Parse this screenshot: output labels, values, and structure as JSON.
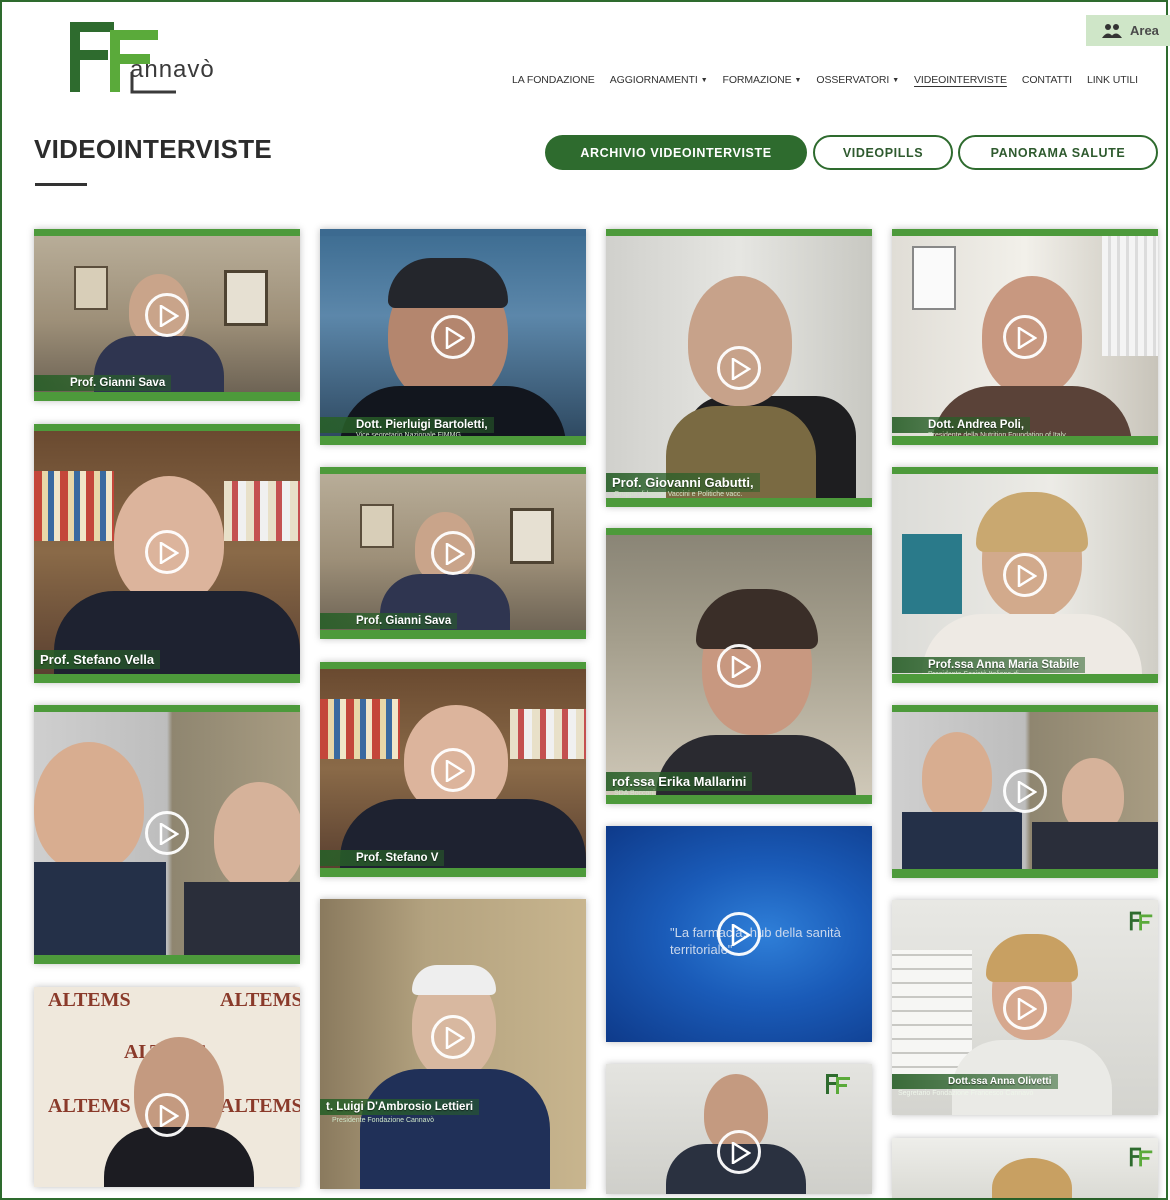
{
  "header": {
    "logo_word": "annavò",
    "area_label": "Area"
  },
  "nav": [
    {
      "label": "LA FONDAZIONE",
      "dropdown": false,
      "active": false
    },
    {
      "label": "AGGIORNAMENTI",
      "dropdown": true,
      "active": false
    },
    {
      "label": "FORMAZIONE",
      "dropdown": true,
      "active": false
    },
    {
      "label": "OSSERVATORI",
      "dropdown": true,
      "active": false
    },
    {
      "label": "VIDEOINTERVISTE",
      "dropdown": false,
      "active": true
    },
    {
      "label": "CONTATTI",
      "dropdown": false,
      "active": false
    },
    {
      "label": "LINK UTILI",
      "dropdown": false,
      "active": false
    }
  ],
  "page": {
    "title": "VIDEOINTERVISTE"
  },
  "tabs": [
    {
      "label": "ARCHIVIO VIDEOINTERVISTE",
      "active": true
    },
    {
      "label": "VIDEOPILLS",
      "active": false
    },
    {
      "label": "PANORAMA SALUTE",
      "active": false
    }
  ],
  "videos": [
    {
      "caption": "Prof. Gianni Sava"
    },
    {
      "caption": "Prof. Stefano Vella"
    },
    {
      "caption": ""
    },
    {
      "caption": ""
    },
    {
      "caption": "Dott. Pierluigi Bartoletti,",
      "subcaption": "Vice segretario Nazionale FIMMG"
    },
    {
      "caption": "Prof. Gianni Sava"
    },
    {
      "caption": "Prof. Stefano V"
    },
    {
      "caption": "t. Luigi D'Ambrosio Lettieri",
      "subcaption": "Presidente Fondazione Cannavò"
    },
    {
      "caption": "Prof. Giovanni Gabutti,",
      "subcaption": "Gruppo di lavoro Vaccini e Politiche vacc."
    },
    {
      "caption": "rof.ssa Erika Mallarini",
      "subcaption": "SDA Bocconi"
    },
    {
      "caption": "",
      "slide_text": "\"La farmacia, hub della sanità territoriale\""
    },
    {
      "caption": ""
    },
    {
      "caption": "Dott. Andrea Poli,",
      "subcaption": "Presidente della Nutrition Foundation of Italy"
    },
    {
      "caption": "Prof.ssa Anna Maria Stabile",
      "subcaption": "Presidente Società Italiana di ..."
    },
    {
      "caption": ""
    },
    {
      "caption": "Dott.ssa Anna Olivetti",
      "subcaption": "Segretario Fondazione Francesco Cannavò"
    },
    {
      "caption": ""
    }
  ],
  "altems_text": "ALTEMS",
  "colors": {
    "brand_green": "#2e6b2e",
    "accent_green": "#4d9a3b",
    "light_green": "#cfe6c8"
  }
}
